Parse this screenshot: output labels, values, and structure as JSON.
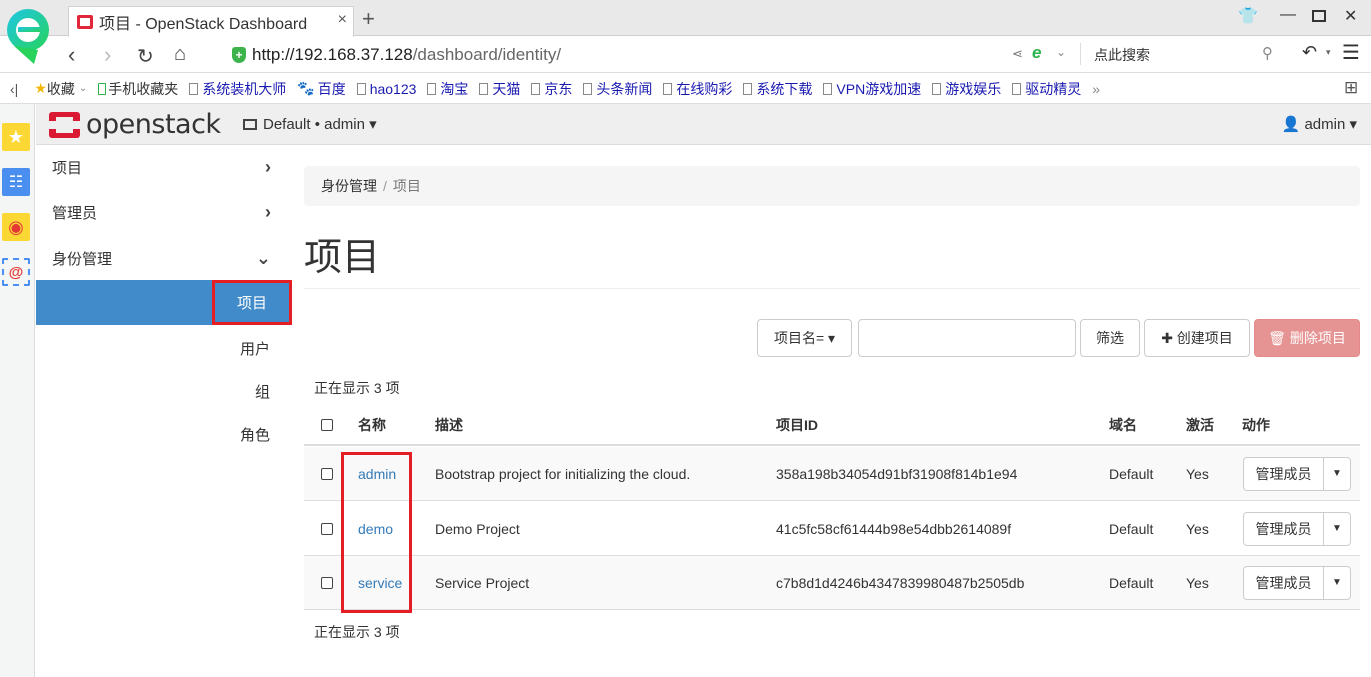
{
  "browser": {
    "tab_title": "项目 - OpenStack Dashboard",
    "new_tab": "+",
    "url_host": "http://192.168.37.128",
    "url_path": "/dashboard/identity/",
    "search_placeholder": "点此搜索",
    "bookmarks": [
      "收藏",
      "手机收藏夹",
      "系统装机大师",
      "百度",
      "hao123",
      "淘宝",
      "天猫",
      "京东",
      "头条新闻",
      "在线购彩",
      "系统下载",
      "VPN游戏加速",
      "游戏娱乐",
      "驱动精灵"
    ],
    "bookmarks_more": "»"
  },
  "header": {
    "logo_text": "openstack",
    "project_switch": "Default • admin ▾",
    "user": "admin ▾"
  },
  "nav": {
    "items": [
      {
        "label": "项目",
        "chevron": "›"
      },
      {
        "label": "管理员",
        "chevron": "›"
      },
      {
        "label": "身份管理",
        "chevron": "⌄"
      }
    ],
    "sub_items": [
      "项目",
      "用户",
      "组",
      "角色"
    ]
  },
  "breadcrumb": {
    "parent": "身份管理",
    "separator": "/",
    "current": "项目"
  },
  "page_title": "项目",
  "toolbar": {
    "filter_field": "项目名= ▾",
    "filter_value": "",
    "filter_button": "筛选",
    "create_button": "✚ 创建项目",
    "delete_button": "🗑 删除项目"
  },
  "count_text": "正在显示 3 项",
  "table": {
    "headers": [
      "名称",
      "描述",
      "项目ID",
      "域名",
      "激活",
      "动作"
    ],
    "rows": [
      {
        "name": "admin",
        "description": "Bootstrap project for initializing the cloud.",
        "id": "358a198b34054d91bf31908f814b1e94",
        "domain": "Default",
        "enabled": "Yes",
        "action": "管理成员"
      },
      {
        "name": "demo",
        "description": "Demo Project",
        "id": "41c5fc58cf61444b98e54dbb2614089f",
        "domain": "Default",
        "enabled": "Yes",
        "action": "管理成员"
      },
      {
        "name": "service",
        "description": "Service Project",
        "id": "c7b8d1d4246b4347839980487b2505db",
        "domain": "Default",
        "enabled": "Yes",
        "action": "管理成员"
      }
    ]
  },
  "colors": {
    "accent": "#428bca",
    "link": "#337ab7",
    "danger": "#e69393",
    "highlight": "#e31e24",
    "brand": "#da1a32"
  }
}
